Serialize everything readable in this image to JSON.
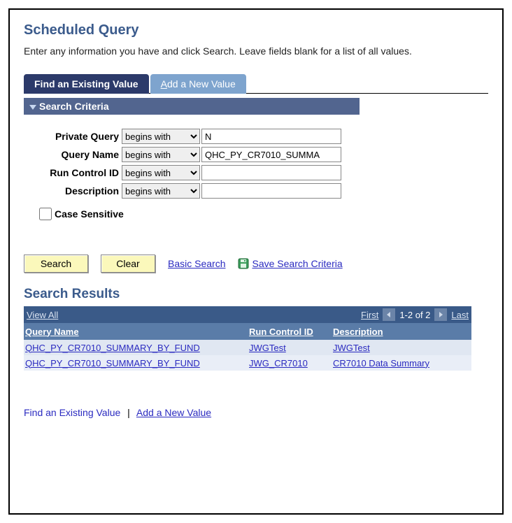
{
  "page": {
    "title": "Scheduled Query",
    "instruction": "Enter any information you have and click Search. Leave fields blank for a list of all values."
  },
  "tabs": {
    "active": "Find an Existing Value",
    "inactive_prefix": "A",
    "inactive_rest": "dd a New Value"
  },
  "criteria": {
    "header": "Search Criteria",
    "fields": [
      {
        "label": "Private Query",
        "op": "begins with",
        "value": "N"
      },
      {
        "label": "Query Name",
        "op": "begins with",
        "value": "QHC_PY_CR7010_SUMMA"
      },
      {
        "label": "Run Control ID",
        "op": "begins with",
        "value": ""
      },
      {
        "label": "Description",
        "op": "begins with",
        "value": ""
      }
    ],
    "case_sensitive_label": "Case Sensitive",
    "case_sensitive_checked": false
  },
  "buttons": {
    "search": "Search",
    "clear": "Clear",
    "basic_search": "Basic Search",
    "save_criteria": "Save Search Criteria"
  },
  "results": {
    "title": "Search Results",
    "bar": {
      "view_all": "View All",
      "first": "First",
      "range": "1-2 of 2",
      "last": "Last"
    },
    "columns": [
      "Query Name",
      "Run Control ID",
      "Description"
    ],
    "rows": [
      {
        "c1": "QHC_PY_CR7010_SUMMARY_BY_FUND",
        "c2": "JWGTest",
        "c3": "JWGTest"
      },
      {
        "c1": "QHC_PY_CR7010_SUMMARY_BY_FUND",
        "c2": "JWG_CR7010",
        "c3": "CR7010 Data Summary"
      }
    ]
  },
  "footer": {
    "find": "Find an Existing Value",
    "add": "Add a New Value"
  }
}
